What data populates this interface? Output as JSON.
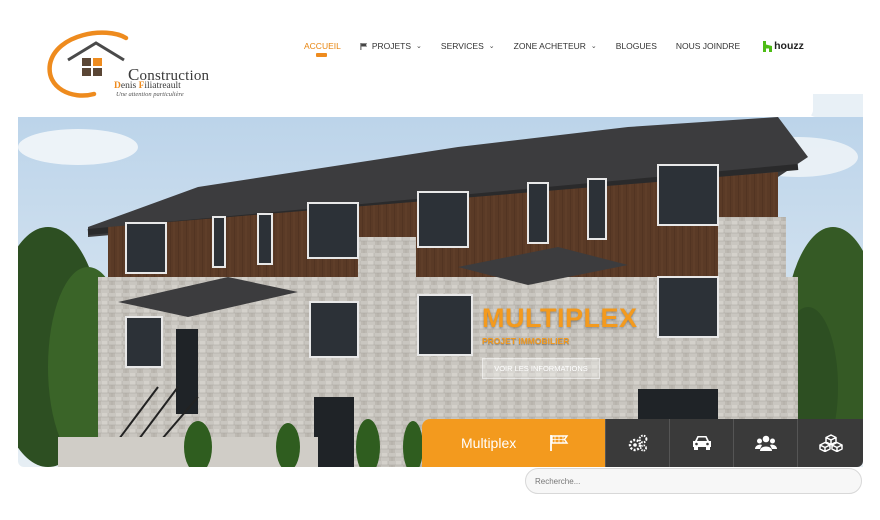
{
  "logo": {
    "line1_first": "C",
    "line1_rest": "onstruction",
    "line2_d": "D",
    "line2_a": "enis ",
    "line2_f": "F",
    "line2_b": "iliatreault",
    "tagline": "Une attention particulière"
  },
  "nav": {
    "items": [
      {
        "label": "ACCUEIL",
        "active": true
      },
      {
        "label": "PROJETS",
        "icon": "flag-icon",
        "dropdown": true
      },
      {
        "label": "SERVICES",
        "dropdown": true
      },
      {
        "label": "ZONE ACHETEUR",
        "dropdown": true
      },
      {
        "label": "BLOGUES"
      },
      {
        "label": "NOUS JOINDRE"
      }
    ],
    "houzz": "houzz"
  },
  "hero": {
    "title": "MULTIPLEX",
    "subtitle": "PROJET IMMOBILIER",
    "button": "VOIR LES INFORMATIONS"
  },
  "tabs": {
    "active_label": "Multiplex",
    "icons": [
      "flag-icon",
      "gears-icon",
      "car-icon",
      "group-icon",
      "cubes-icon"
    ]
  },
  "search": {
    "placeholder": "Recherche..."
  },
  "colors": {
    "accent": "#f39a1e",
    "dark": "#3a3a3a"
  }
}
